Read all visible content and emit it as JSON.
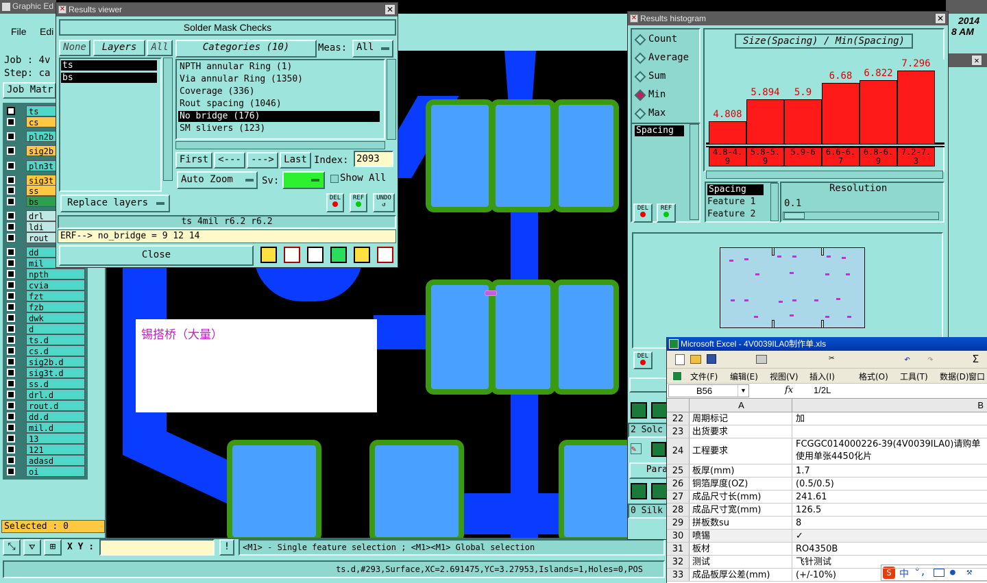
{
  "ge": {
    "title": "Graphic Ed",
    "menu_file": "File",
    "menu_edit": "Edi",
    "job": "Job : 4v",
    "step": "Step: ca",
    "job_matrix": "Job Matr",
    "selected": "Selected : 0",
    "xy_label": "X Y :",
    "status_msg": "<M1> - Single feature selection ; <M1><M1> Global selection",
    "bottom_status": "ts.d,#293,Surface,XC=2.691475,YC=3.27953,Islands=1,Holes=0,POS",
    "right_date_1": "2014",
    "right_date_2": "8 AM"
  },
  "layers": [
    {
      "name": "ts",
      "color": "#4fd8c8"
    },
    {
      "name": "cs",
      "color": "#ffc840"
    },
    {
      "name": "pln2b",
      "color": "#4fd8c8"
    },
    {
      "name": "sig2b",
      "color": "#ffc840"
    },
    {
      "name": "pln3t",
      "color": "#4fd8c8"
    },
    {
      "name": "sig3t",
      "color": "#ffc840"
    },
    {
      "name": "ss",
      "color": "#ffc840"
    },
    {
      "name": "bs",
      "color": "#2aa050"
    },
    {
      "name": "drl",
      "color": "#bfe8e4"
    },
    {
      "name": "ldi",
      "color": "#bfe8e4"
    },
    {
      "name": "rout",
      "color": "#bfe8e4"
    },
    {
      "name": "dd",
      "color": "#4fd8c8"
    },
    {
      "name": "mil",
      "color": "#4fd8c8"
    },
    {
      "name": "npth",
      "color": "#4fd8c8"
    },
    {
      "name": "cvia",
      "color": "#4fd8c8"
    },
    {
      "name": "fzt",
      "color": "#4fd8c8"
    },
    {
      "name": "fzb",
      "color": "#4fd8c8"
    },
    {
      "name": "dwk",
      "color": "#4fd8c8"
    },
    {
      "name": "d",
      "color": "#4fd8c8"
    },
    {
      "name": "ts.d",
      "color": "#4fd8c8"
    },
    {
      "name": "cs.d",
      "color": "#4fd8c8"
    },
    {
      "name": "sig2b.d",
      "color": "#4fd8c8"
    },
    {
      "name": "sig3t.d",
      "color": "#4fd8c8"
    },
    {
      "name": "ss.d",
      "color": "#4fd8c8"
    },
    {
      "name": "drl.d",
      "color": "#4fd8c8"
    },
    {
      "name": "rout.d",
      "color": "#4fd8c8"
    },
    {
      "name": "dd.d",
      "color": "#4fd8c8"
    },
    {
      "name": "mil.d",
      "color": "#4fd8c8"
    },
    {
      "name": "13",
      "color": "#4fd8c8"
    },
    {
      "name": "121",
      "color": "#4fd8c8"
    },
    {
      "name": "adasd",
      "color": "#4fd8c8"
    },
    {
      "name": "oi",
      "color": "#4fd8c8"
    }
  ],
  "rv": {
    "title": "Results viewer",
    "header": "Solder Mask Checks",
    "none": "None",
    "layers": "Layers",
    "all": "All",
    "layer_items": [
      "ts",
      "bs"
    ],
    "categories": "Categories (10)",
    "meas_label": "Meas:",
    "meas_value": "All",
    "category_items": [
      "NPTH annular Ring (1)",
      "Via annular Ring (1350)",
      "Coverage (336)",
      "Rout spacing (1046)",
      "No bridge (176)",
      "SM slivers (123)"
    ],
    "first": "First",
    "prev": "<---",
    "next": "--->",
    "last": "Last",
    "index_label": "Index:",
    "index_value": "2093",
    "auto_zoom": "Auto Zoom",
    "sv_label": "Sv:",
    "show_all": "Show All",
    "replace_layers": "Replace layers",
    "del": "DEL",
    "ref": "REF",
    "undo": "UNDO",
    "info_line": "ts 4mil   r6.2   r6.2",
    "erf_line": "ERF--> no_bridge = 9 12 14",
    "close": "Close"
  },
  "note": {
    "text": "锡搭桥（大量）"
  },
  "rh": {
    "title": "Results histogram",
    "radio": [
      "Count",
      "Average",
      "Sum",
      "Min",
      "Max"
    ],
    "selected_radio": "Min",
    "chart_title": "Size(Spacing) / Min(Spacing)",
    "list_item": "Spacing",
    "list_items2": [
      "Spacing",
      "Feature 1",
      "Feature 2"
    ],
    "resolution_label": "Resolution",
    "resolution_value": "0.1",
    "del": "DEL",
    "ref": "REF",
    "side_1": "2 Solc",
    "side_2": "Para",
    "side_3": "0 Silk"
  },
  "chart_data": {
    "type": "bar",
    "title": "Size(Spacing) / Min(Spacing)",
    "categories": [
      "4.8-4.9",
      "5.8-5.9",
      "5.9-6",
      "6.6-6.7",
      "6.8-6.9",
      "7.2-7.3"
    ],
    "values": [
      4.808,
      5.894,
      5.9,
      6.68,
      6.822,
      7.296
    ]
  },
  "xl": {
    "title": "Microsoft Excel - 4V0039ILA0制作单.xls",
    "menu": [
      "文件(F)",
      "编辑(E)",
      "视图(V)",
      "插入(I)",
      "格式(O)",
      "工具(T)",
      "数据(D)",
      "窗口"
    ],
    "cell_ref": "B56",
    "fx": "fx",
    "formula": "1/2L",
    "col_a": "A",
    "col_b": "B",
    "rows": [
      {
        "n": "22",
        "a": "周期标记",
        "b": "加"
      },
      {
        "n": "23",
        "a": "出货要求",
        "b": ""
      },
      {
        "n": "24",
        "a": "工程要求",
        "b": "FCGGC014000226-39(4V0039ILA0)请购单",
        "b2": "使用单张4450化片"
      },
      {
        "n": "25",
        "a": "板厚(mm)",
        "b": "1.7"
      },
      {
        "n": "26",
        "a": "铜箔厚度(OZ)",
        "b": " (0.5/0.5)"
      },
      {
        "n": "27",
        "a": "成品尺寸长(mm)",
        "b": "241.61"
      },
      {
        "n": "28",
        "a": "成品尺寸宽(mm)",
        "b": "126.5"
      },
      {
        "n": "29",
        "a": "拼板数su",
        "b": "8"
      },
      {
        "n": "30",
        "a": "喷锡",
        "b": "✓"
      },
      {
        "n": "31",
        "a": "板材",
        "b": "RO4350B"
      },
      {
        "n": "32",
        "a": "测试",
        "b": "飞针测试"
      },
      {
        "n": "33",
        "a": "成品板厚公差(mm)",
        "b": "(+/-10%)"
      }
    ],
    "ime": "中"
  }
}
